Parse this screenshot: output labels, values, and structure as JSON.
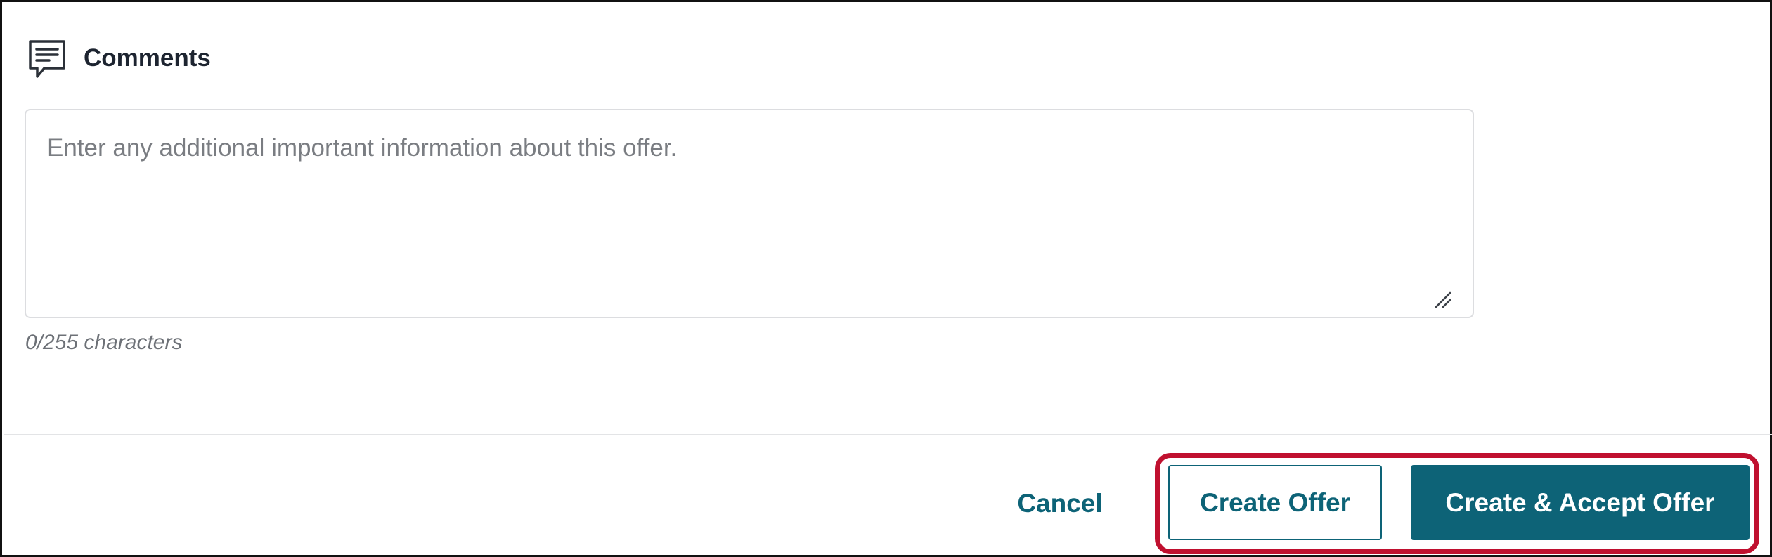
{
  "comments": {
    "title": "Comments",
    "icon": "comment-icon",
    "input_value": "",
    "input_placeholder": "Enter any additional important information about this offer.",
    "char_count": "0/255 characters"
  },
  "footer": {
    "cancel_label": "Cancel",
    "create_offer_label": "Create Offer",
    "create_accept_label": "Create & Accept Offer"
  },
  "colors": {
    "brand": "#0d6377",
    "highlight": "#c0102f",
    "title_text": "#1d2430",
    "muted_text": "#6d7177"
  }
}
